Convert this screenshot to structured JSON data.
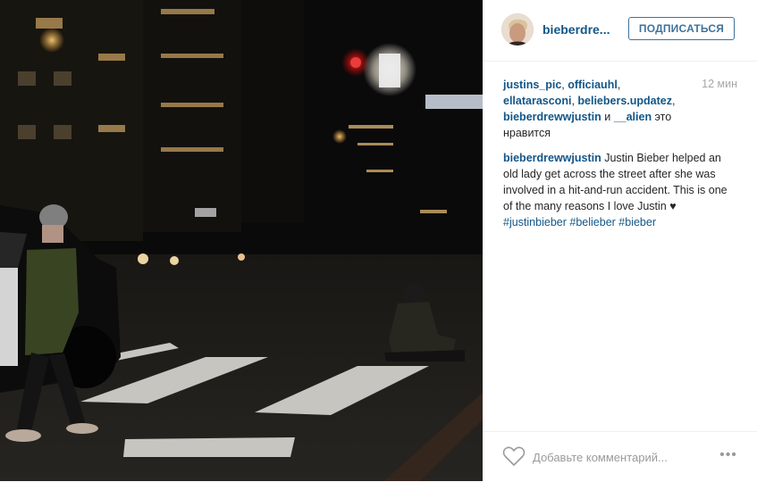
{
  "post": {
    "username": "bieberdre...",
    "follow_label": "ПОДПИСАТЬСЯ",
    "timestamp": "12 мин"
  },
  "likes": {
    "users": [
      "justins_pic",
      "officiauhl",
      "ellatarasconi",
      "beliebers.updatez",
      "bieberdrewwjustin",
      "__alien"
    ],
    "sep1": ", ",
    "and": " и ",
    "suffix": " это нравится"
  },
  "caption": {
    "author": "bieberdrewwjustin",
    "text": " Justin Bieber helped an old lady get across the street after she was involved in a hit-and-run accident. This is one of the many reasons I love Justin ♥",
    "hashtags": [
      "#justinbieber",
      "#belieber",
      "#bieber"
    ]
  },
  "comment": {
    "placeholder": "Добавьте комментарий...",
    "more_label": "•••"
  },
  "colors": {
    "link": "#125688",
    "follow": "#3f729b",
    "muted": "#a5a7aa"
  },
  "icons": {
    "like": "heart-outline-icon",
    "more": "ellipsis-icon"
  }
}
